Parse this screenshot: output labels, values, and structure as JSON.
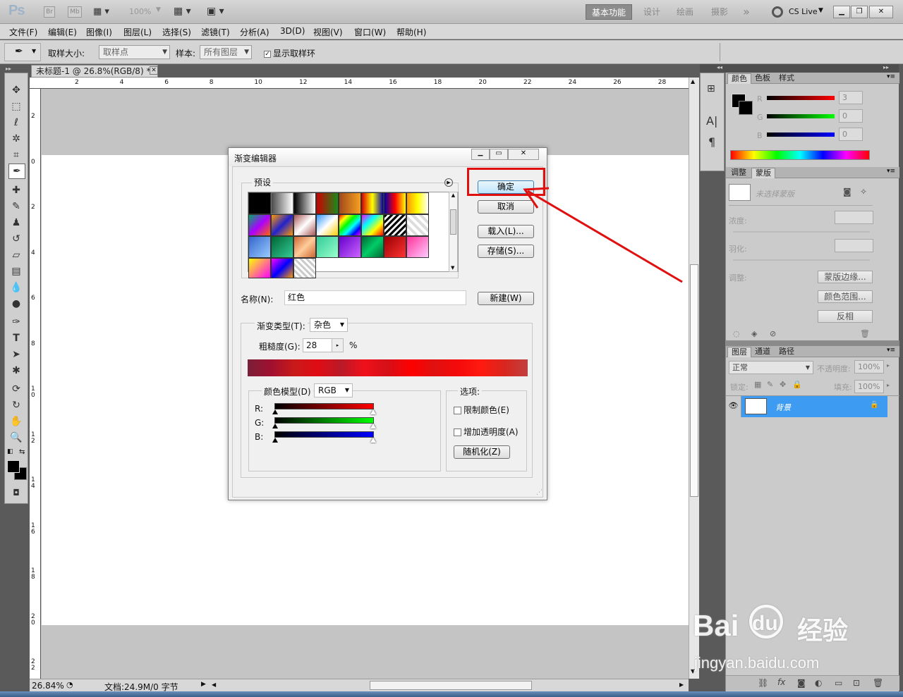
{
  "app": {
    "logo": "Ps",
    "br": "Br",
    "mb": "Mb",
    "zoom": "100%",
    "workspaces": [
      "基本功能",
      "设计",
      "绘画",
      "摄影"
    ],
    "more": "»",
    "cslive": "CS Live"
  },
  "menu": [
    "文件(F)",
    "编辑(E)",
    "图像(I)",
    "图层(L)",
    "选择(S)",
    "滤镜(T)",
    "分析(A)",
    "3D(D)",
    "视图(V)",
    "窗口(W)",
    "帮助(H)"
  ],
  "options": {
    "sample_size_label": "取样大小:",
    "sample_size_value": "取样点",
    "sample_label": "样本:",
    "sample_value": "所有图层",
    "show_ring_label": "显示取样环"
  },
  "document": {
    "tab_title": "未标题-1 @ 26.8%(RGB/8) *",
    "ruler_top": [
      "2",
      "4",
      "6",
      "8",
      "10",
      "12",
      "14",
      "16",
      "18",
      "20",
      "22",
      "24",
      "26",
      "28"
    ],
    "ruler_left": [
      "2",
      "0",
      "2",
      "4",
      "6",
      "8",
      "1 0",
      "1 2",
      "1 4",
      "1 6",
      "1 8",
      "2 0",
      "2 2"
    ],
    "zoom_status": "26.84%",
    "doc_status": "文档:24.9M/0 字节"
  },
  "dialog": {
    "title": "渐变编辑器",
    "presets_label": "预设",
    "ok": "确定",
    "cancel": "取消",
    "load": "载入(L)...",
    "save": "存储(S)...",
    "name_label": "名称(N):",
    "name_value": "红色",
    "new_button": "新建(W)",
    "gradient_type_label": "渐变类型(T):",
    "gradient_type_value": "杂色",
    "roughness_label": "粗糙度(G):",
    "roughness_value": "28",
    "percent": "%",
    "color_model_label": "颜色模型(D)",
    "color_model_value": "RGB",
    "r": "R:",
    "g": "G:",
    "b": "B:",
    "options_label": "选项:",
    "restrict_colors": "限制颜色(E)",
    "add_transparency": "增加透明度(A)",
    "randomize": "随机化(Z)"
  },
  "color_panel": {
    "tabs": [
      "颜色",
      "色板",
      "样式"
    ],
    "r_label": "R",
    "g_label": "G",
    "b_label": "B",
    "r": "3",
    "g": "0",
    "b": "0"
  },
  "masks_panel": {
    "tabs": [
      "调整",
      "蒙版"
    ],
    "no_mask": "未选择蒙版",
    "density": "浓度:",
    "feather": "羽化:",
    "refine": "调整:",
    "mask_edge": "蒙版边缘...",
    "color_range": "颜色范围...",
    "invert": "反相"
  },
  "layers_panel": {
    "tabs": [
      "图层",
      "通道",
      "路径"
    ],
    "blend_mode": "正常",
    "opacity_label": "不透明度:",
    "opacity": "100%",
    "lock_label": "锁定:",
    "fill_label": "填充:",
    "fill": "100%",
    "layer_name": "背景"
  },
  "watermark": {
    "brand": "Bai",
    "brand2": "du",
    "cn": "经验",
    "url": "jingyan.baidu.com"
  },
  "colors": {
    "highlight_red": "#e01010",
    "selected_layer": "#3d9bf2"
  }
}
